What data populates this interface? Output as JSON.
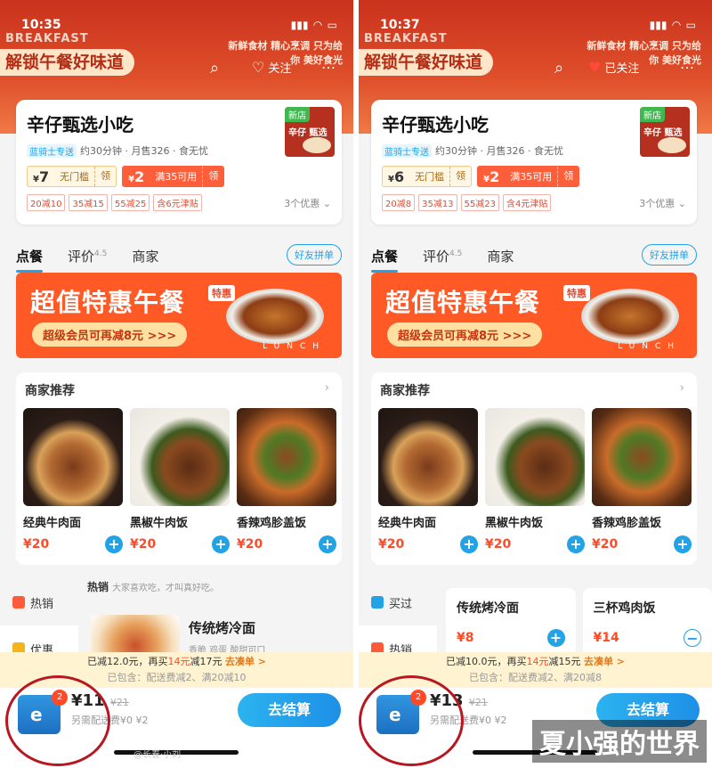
{
  "phones": [
    {
      "status": {
        "time": "10:35"
      },
      "header": {
        "breakfast": "BREAKFAST",
        "banner": "解锁午餐好味道",
        "slogan": "新鲜食材 精心烹调 只为给你 美好食光",
        "follow": "关注"
      },
      "shop": {
        "name": "辛仔甄选小吃",
        "delivery_tag": "蓝骑士专送",
        "meta": "约30分钟 · 月售326 · 食无忧",
        "logo_new": "新店",
        "logo_text": "辛仔 甄选",
        "coupons": [
          {
            "amount": "7",
            "label": "无门槛",
            "action": "领"
          },
          {
            "amount": "2",
            "label": "满35可用",
            "action": "领"
          }
        ],
        "promos": [
          "20减10",
          "35减15",
          "55减25",
          "含6元津贴"
        ],
        "more": "3个优惠"
      },
      "tabs": {
        "order": "点餐",
        "review": "评价",
        "review_score": "4.5",
        "merchant": "商家",
        "group": "好友拼单"
      },
      "ad": {
        "title": "超值特惠午餐",
        "sub": "超级会员可再减8元 >>>",
        "tag": "特惠",
        "lunch": "LUNCH"
      },
      "recommend": {
        "title": "商家推荐",
        "dishes": [
          {
            "name": "经典牛肉面",
            "price": "¥20"
          },
          {
            "name": "黑椒牛肉饭",
            "price": "¥20"
          },
          {
            "name": "香辣鸡胗盖饭",
            "price": "¥20"
          }
        ]
      },
      "sidebar": [
        "热销",
        "优惠"
      ],
      "list": {
        "hot": "热销",
        "hot_desc": "大家喜欢吃，才叫真好吃。",
        "item_name": "传统烤冷面",
        "item_desc": "香脆 鸡蛋 酸甜可口"
      },
      "notice": {
        "line1_a": "已减12.0元，再买",
        "line1_b": "14元",
        "line1_c": "减17元",
        "link": "去凑单 >",
        "line2": "已包含：配送费减2、满20减10"
      },
      "cart": {
        "count": "2",
        "price": "¥11",
        "orig": "¥21",
        "fee": "另需配送费¥0 ¥2",
        "checkout": "去结算"
      }
    },
    {
      "status": {
        "time": "10:37"
      },
      "header": {
        "breakfast": "BREAKFAST",
        "banner": "解锁午餐好味道",
        "slogan": "新鲜食材 精心烹调 只为给你 美好食光",
        "follow": "已关注"
      },
      "shop": {
        "name": "辛仔甄选小吃",
        "delivery_tag": "蓝骑士专送",
        "meta": "约30分钟 · 月售326 · 食无忧",
        "logo_new": "新店",
        "logo_text": "辛仔 甄选",
        "coupons": [
          {
            "amount": "6",
            "label": "无门槛",
            "action": "领"
          },
          {
            "amount": "2",
            "label": "满35可用",
            "action": "领"
          }
        ],
        "promos": [
          "20减8",
          "35减13",
          "55减23",
          "含4元津贴"
        ],
        "more": "3个优惠"
      },
      "tabs": {
        "order": "点餐",
        "review": "评价",
        "review_score": "4.5",
        "merchant": "商家",
        "group": "好友拼单"
      },
      "ad": {
        "title": "超值特惠午餐",
        "sub": "超级会员可再减8元 >>>",
        "tag": "特惠",
        "lunch": "LUNCH"
      },
      "recommend": {
        "title": "商家推荐",
        "dishes": [
          {
            "name": "经典牛肉面",
            "price": "¥20"
          },
          {
            "name": "黑椒牛肉饭",
            "price": "¥20"
          },
          {
            "name": "香辣鸡胗盖饭",
            "price": "¥20"
          }
        ]
      },
      "sidebar": [
        "买过",
        "热销"
      ],
      "list": {
        "card1_name": "传统烤冷面",
        "card1_price": "¥8",
        "card2_name": "三杯鸡肉饭",
        "card2_price": "¥14"
      },
      "notice": {
        "line1_a": "已减10.0元，再买",
        "line1_b": "14元",
        "line1_c": "减15元",
        "link": "去凑单 >",
        "line2": "已包含：配送费减2、满20减8"
      },
      "cart": {
        "count": "2",
        "price": "¥13",
        "orig": "¥21",
        "fee": "另需配送费¥0 ¥2",
        "checkout": "去结算"
      }
    }
  ],
  "watermark": {
    "weibo": "@长春·小刘",
    "site": "夏小强的世界"
  },
  "colors": {
    "accent_blue": "#23a2e6",
    "brand_red": "#e0502b",
    "price_red": "#ff4a26",
    "circle_red": "#b8171f"
  }
}
